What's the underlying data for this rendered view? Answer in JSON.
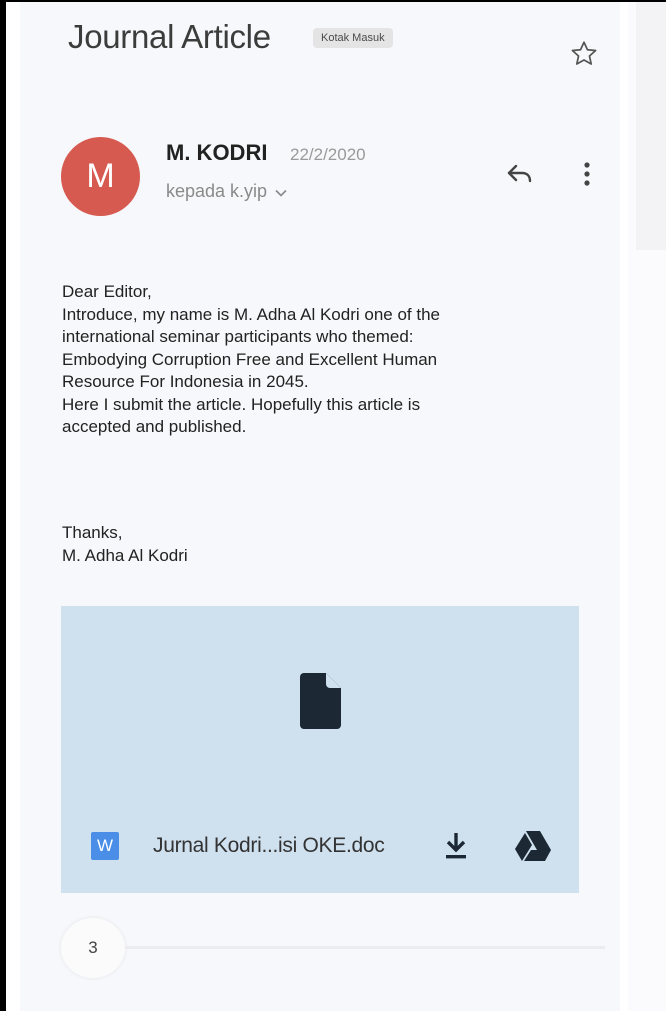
{
  "email": {
    "subject": "Journal Article",
    "label": "Kotak Masuk",
    "sender_initial": "M",
    "sender_name": "M. KODRI",
    "date": "22/2/2020",
    "recipient_line": "kepada k.yip",
    "body_lines": [
      "Dear Editor,",
      "Introduce, my name is M. Adha Al Kodri one of the",
      "international seminar participants who themed:",
      "Embodying Corruption Free and Excellent Human",
      "Resource For Indonesia in 2045.",
      "Here I submit the article. Hopefully this article is",
      "accepted and published."
    ],
    "signature_lines": [
      "Thanks,",
      "M. Adha Al Kodri"
    ]
  },
  "attachment": {
    "type_badge": "W",
    "file_name": "Jurnal Kodri...isi OKE.doc"
  },
  "thread": {
    "count": "3"
  },
  "icons": {
    "star": "star-outline-icon",
    "reply": "reply-icon",
    "more": "more-vert-icon",
    "chevron": "chevron-down-icon",
    "file": "file-icon",
    "download": "download-icon",
    "drive": "google-drive-icon"
  },
  "colors": {
    "avatar": "#d65a4f",
    "attachment_bg": "#cfe0ef",
    "word_icon": "#4a8ee8"
  }
}
